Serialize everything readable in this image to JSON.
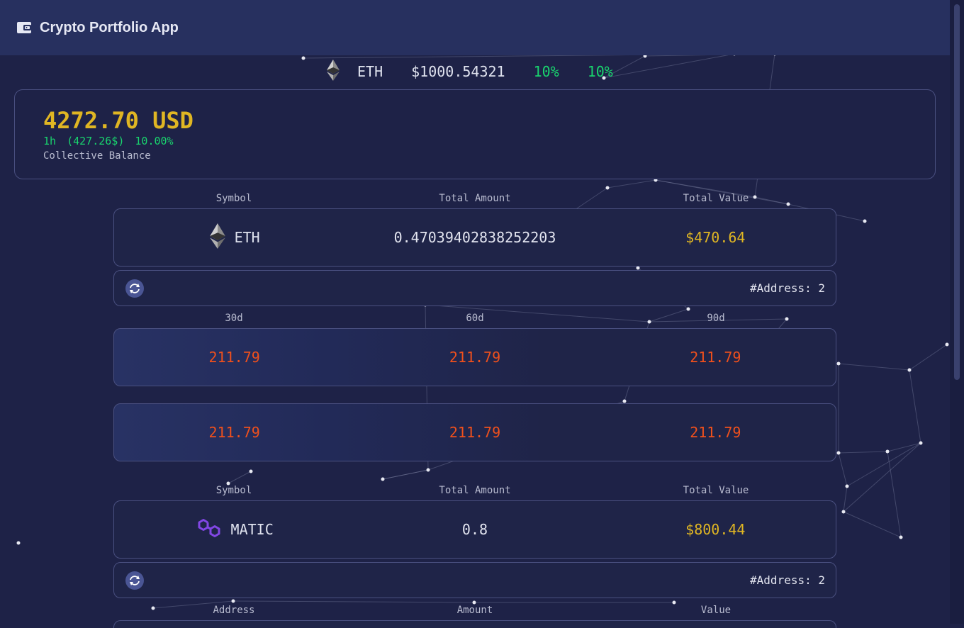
{
  "app": {
    "title": "Crypto Portfolio App",
    "icon": "wallet-icon"
  },
  "ticker": {
    "symbol": "ETH",
    "price": "$1000.54321",
    "change_1": "10%",
    "change_2": "10%",
    "icon": "ethereum-icon"
  },
  "balance": {
    "value": "4272.70 USD",
    "change_period": "1h",
    "change_amount": "(427.26$)",
    "change_percent": "10.00%",
    "label": "Collective Balance"
  },
  "columns": {
    "symbol": "Symbol",
    "total_amount": "Total Amount",
    "total_value": "Total Value"
  },
  "periods_header": {
    "d30": "30d",
    "d60": "60d",
    "d90": "90d"
  },
  "address_columns": {
    "address": "Address",
    "amount": "Amount",
    "value": "Value"
  },
  "assets": [
    {
      "symbol": "ETH",
      "icon": "ethereum-icon",
      "total_amount": "0.47039402838252203",
      "total_value": "$470.64",
      "addresses": "#Address: 2",
      "periods": [
        [
          "211.79",
          "211.79",
          "211.79"
        ],
        [
          "211.79",
          "211.79",
          "211.79"
        ]
      ]
    },
    {
      "symbol": "MATIC",
      "icon": "polygon-icon",
      "total_amount": "0.8",
      "total_value": "$800.44",
      "addresses": "#Address: 2"
    }
  ],
  "colors": {
    "background": "#1e2247",
    "header": "#27305f",
    "gold": "#e0b623",
    "positive": "#19d46e",
    "period_value": "#f0501c",
    "card_border": "#4a5080"
  }
}
